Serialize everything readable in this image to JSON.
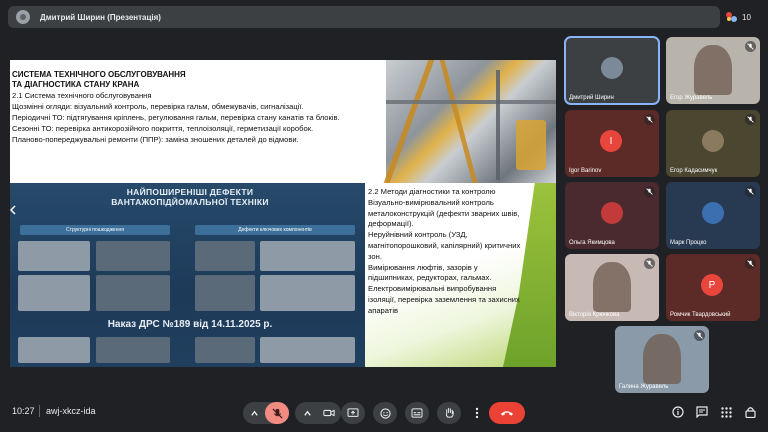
{
  "presenter_bar": {
    "title": "Дмитрий Ширин (Презентація)",
    "participant_count": "10"
  },
  "slide": {
    "heading_line1": "СИСТЕМА ТЕХНІЧНОГО ОБСЛУГОВУВАННЯ",
    "heading_line2": "ТА ДІАГНОСТИКА СТАНУ КРАНА",
    "section1_title": "2.1 Система технічного обслуговування",
    "section1_lines": [
      "Щозмінні огляди: візуальний контроль, перевірка гальм, обмежувачів, сигналізації.",
      "Періодичні ТО: підтягування кріплень, регулювання гальм, перевірка стану канатів та блоків.",
      "Сезонні ТО: перевірка антикорозійного покриття, теплоізоляції, герметизації коробок.",
      "Планово-попереджувальні ремонти (ППР): заміна зношених деталей до відмови."
    ],
    "poster": {
      "title_line1": "НАЙПОШИРЕНІШІ ДЕФЕКТИ",
      "title_line2": "ВАНТАЖОПІДЙОМАЛЬНОЇ ТЕХНІКИ",
      "col_left": "Структурні пошкодження",
      "col_right": "Дефекти ключових компонентів",
      "order": "Наказ ДРС №189 від 14.11.2025 р."
    },
    "section2_lines": [
      "2.2 Методи діагностики та контролю",
      "Візуально-вимірювальний контроль металоконструкцій (дефекти зварних швів, деформації).",
      "Неруйнівний контроль (УЗД, магнітопорошковий, капілярний) критичних зон.",
      "Вимірювання люфтів, зазорів у підшипниках, редукторах, гальмах.",
      "Електровимірювальні випробування ізоляції, перевірка заземлення та захисних апаратів"
    ]
  },
  "participants": [
    {
      "name": "Дмитрий Ширин",
      "bg": "#3c4043",
      "initial": "",
      "avatar_color": "#7a8a99",
      "muted": false,
      "active": true
    },
    {
      "name": "Егор Журавель",
      "bg": "#b8b4ab",
      "initial": "",
      "avatar_color": "",
      "muted": true,
      "active": false
    },
    {
      "name": "Igor Barinov",
      "bg": "#5c2b27",
      "initial": "I",
      "avatar_color": "#e8453c",
      "muted": true,
      "active": false
    },
    {
      "name": "Егор Кадасимчук",
      "bg": "#4a4630",
      "initial": "",
      "avatar_color": "#8a7a60",
      "muted": true,
      "active": false
    },
    {
      "name": "Ольга Якимцова",
      "bg": "#4a2a2e",
      "initial": "",
      "avatar_color": "#c23a3a",
      "muted": true,
      "active": false
    },
    {
      "name": "Марк Процко",
      "bg": "#283a52",
      "initial": "",
      "avatar_color": "#3b6fb0",
      "muted": true,
      "active": false
    },
    {
      "name": "Вікторія Крючкова",
      "bg": "#c7b9b4",
      "initial": "",
      "avatar_color": "",
      "muted": true,
      "active": false
    },
    {
      "name": "Ромчик Твардовський",
      "bg": "#5c2b27",
      "initial": "Р",
      "avatar_color": "#e8453c",
      "muted": true,
      "active": false
    },
    {
      "name": "Галина Журавель",
      "bg": "#8a9aa8",
      "initial": "",
      "avatar_color": "",
      "muted": true,
      "active": false
    }
  ],
  "bottom_bar": {
    "time": "10:27",
    "meeting_code": "awj-xkcz-ida"
  },
  "colors": {
    "background": "#202124",
    "end_call": "#ea4335",
    "mic_off": "#f28b82",
    "active_outline": "#8ab4f8"
  },
  "icons": [
    "chevron-up-icon",
    "mic-off-icon",
    "camera-icon",
    "present-icon",
    "emoji-icon",
    "captions-icon",
    "raise-hand-icon",
    "more-icon",
    "end-call-icon",
    "info-icon",
    "chat-icon",
    "people-icon",
    "apps-icon",
    "lock-icon"
  ]
}
